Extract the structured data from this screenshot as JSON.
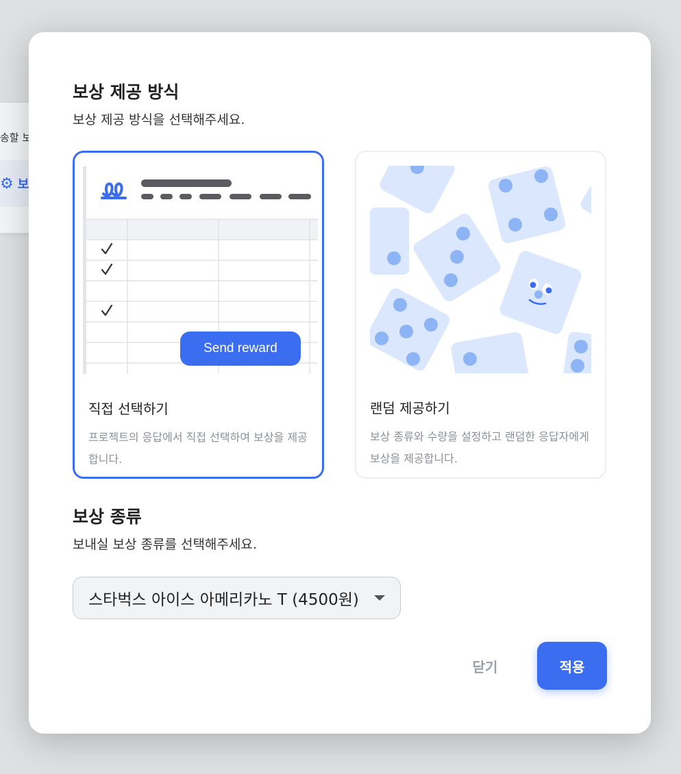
{
  "background": {
    "partial_text": "송할 보",
    "partial_item_label": "보"
  },
  "modal": {
    "method_title": "보상 제공 방식",
    "method_subtitle": "보상 제공 방식을 선택해주세요.",
    "cards": [
      {
        "title": "직접 선택하기",
        "description": "프로젝트의 응답에서 직접 선택하여 보상을 제공합니다.",
        "selected": true,
        "illustration_button": "Send reward"
      },
      {
        "title": "랜덤 제공하기",
        "description": "보상 종류와 수량을 설정하고 랜덤한 응답자에게 보상을 제공합니다.",
        "selected": false
      }
    ],
    "type_title": "보상 종류",
    "type_subtitle": "보내실 보상 종류를 선택해주세요.",
    "reward_select_value": "스타벅스 아이스 아메리카노 T (4500원)",
    "close_label": "닫기",
    "apply_label": "적용"
  },
  "colors": {
    "accent": "#3a6df0",
    "dice_fill": "#dbe7fc",
    "dice_dot": "#8db4f5"
  }
}
